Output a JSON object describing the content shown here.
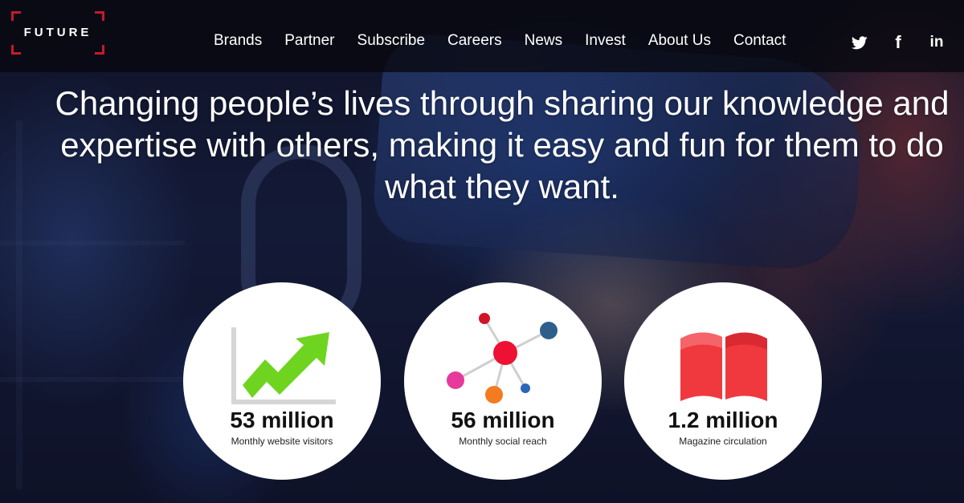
{
  "logo": {
    "text": "FUTURE"
  },
  "nav": {
    "links": [
      {
        "label": "Brands"
      },
      {
        "label": "Partner"
      },
      {
        "label": "Subscribe"
      },
      {
        "label": "Careers"
      },
      {
        "label": "News"
      },
      {
        "label": "Invest"
      },
      {
        "label": "About Us"
      },
      {
        "label": "Contact"
      }
    ],
    "social": [
      {
        "icon": "twitter-icon"
      },
      {
        "icon": "facebook-icon",
        "glyph": "f"
      },
      {
        "icon": "linkedin-icon",
        "glyph": "in"
      }
    ]
  },
  "hero": {
    "headline": "Changing people’s lives through sharing our knowledge and expertise with others, making it easy and fun for them to do what they want."
  },
  "stats": [
    {
      "value": "53 million",
      "label": "Monthly website visitors",
      "icon": "growth-chart-icon"
    },
    {
      "value": "56 million",
      "label": "Monthly social reach",
      "icon": "social-network-icon"
    },
    {
      "value": "1.2 million",
      "label": "Magazine circulation",
      "icon": "open-book-icon"
    }
  ],
  "colors": {
    "brand_red": "#c61a2b",
    "chart_green": "#6fd420",
    "book_red": "#f0393f"
  }
}
